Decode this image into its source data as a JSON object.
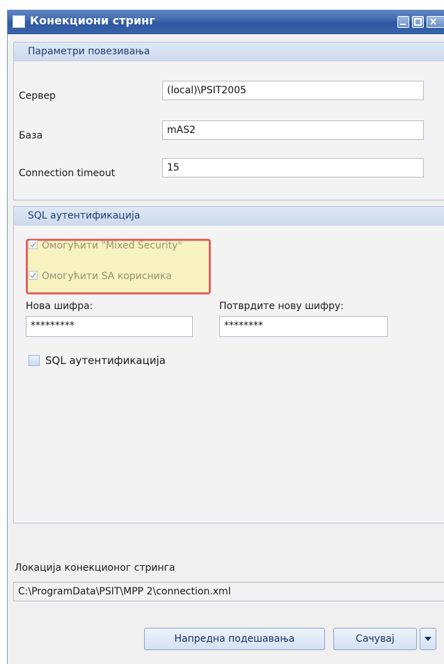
{
  "window": {
    "title": "Конекциони стринг"
  },
  "connection_params": {
    "header": "Параметри повезивања",
    "server_label": "Сервер",
    "server_value": "(local)\\PSIT2005",
    "database_label": "База",
    "database_value": "mAS2",
    "timeout_label": "Connection timeout",
    "timeout_value": "15"
  },
  "sql_auth": {
    "header": "SQL аутентификација",
    "mixed_security_label": "Омогућити \"Mixed Security\"",
    "mixed_security_checked": true,
    "sa_user_label": "Омогућити SA корисника",
    "sa_user_checked": true,
    "new_password_label": "Нова шифра:",
    "new_password_value": "*********",
    "confirm_password_label": "Потврдите нову шифру:",
    "confirm_password_value": "********",
    "sql_auth_checkbox_label": "SQL аутентификација",
    "sql_auth_checked": false
  },
  "location": {
    "label": "Локација конекционог стринга",
    "value": "C:\\ProgramData\\PSIT\\MPP 2\\connection.xml"
  },
  "buttons": {
    "advanced_label": "Напредна подешавања",
    "save_label": "Сачувај"
  },
  "colors": {
    "titlebar": "#3f68ad",
    "highlight_border": "#e36061",
    "highlight_fill": "#fcf096"
  }
}
